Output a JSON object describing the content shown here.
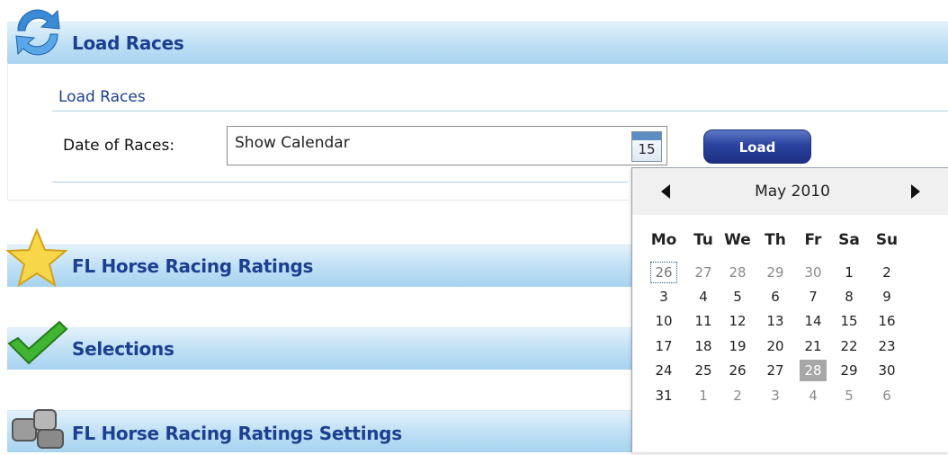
{
  "panels": {
    "load_races": {
      "title": "Load Races",
      "icon": "refresh-icon"
    },
    "ratings": {
      "title": "FL Horse Racing Ratings",
      "icon": "star-icon"
    },
    "selections": {
      "title": "Selections",
      "icon": "checkmark-icon"
    },
    "settings": {
      "title": "FL Horse Racing Ratings Settings",
      "icon": "gears-icon"
    }
  },
  "load_form": {
    "section_title": "Load Races",
    "date_label": "Date of Races:",
    "date_value": "Show Calendar",
    "calendar_button_day": "15",
    "load_button": "Load"
  },
  "calendar": {
    "month_label": "May 2010",
    "weekdays": [
      "Mo",
      "Tu",
      "We",
      "Th",
      "Fr",
      "Sa",
      "Su"
    ],
    "weeks": [
      [
        "26",
        "27",
        "28",
        "29",
        "30",
        "1",
        "2"
      ],
      [
        "3",
        "4",
        "5",
        "6",
        "7",
        "8",
        "9"
      ],
      [
        "10",
        "11",
        "12",
        "13",
        "14",
        "15",
        "16"
      ],
      [
        "17",
        "18",
        "19",
        "20",
        "21",
        "22",
        "23"
      ],
      [
        "24",
        "25",
        "26",
        "27",
        "28",
        "29",
        "30"
      ],
      [
        "31",
        "1",
        "2",
        "3",
        "4",
        "5",
        "6"
      ]
    ],
    "today": "26",
    "selected": "28"
  },
  "colors": {
    "header_blue": "#bddff5",
    "title_text": "#1c3f8f",
    "button_blue": "#2a43a0",
    "selected_day": "#a7a7a7"
  }
}
